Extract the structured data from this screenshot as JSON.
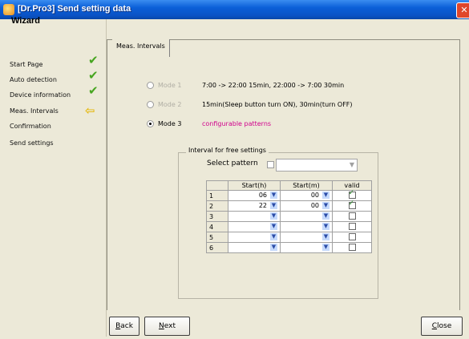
{
  "window": {
    "title": "[Dr.Pro3] Send setting data",
    "close_label": "✕"
  },
  "wizard": {
    "title": "Wizard",
    "steps": [
      {
        "label": "Start Page",
        "status": "done"
      },
      {
        "label": "Auto detection",
        "status": "done"
      },
      {
        "label": "Device information",
        "status": "done"
      },
      {
        "label": "Meas. Intervals",
        "status": "current"
      },
      {
        "label": "Confirmation",
        "status": "pending"
      },
      {
        "label": "Send settings",
        "status": "pending"
      }
    ]
  },
  "tabs": [
    {
      "label": "Meas. Intervals"
    }
  ],
  "modes": [
    {
      "label": "Mode 1",
      "description": "7:00 -> 22:00 15min, 22:000 -> 7:00 30min",
      "selected": false,
      "enabled": false
    },
    {
      "label": "Mode 2",
      "description": "15min(Sleep button turn ON), 30min(turn OFF)",
      "selected": false,
      "enabled": false
    },
    {
      "label": "Mode 3",
      "description": "configurable patterns",
      "selected": true,
      "enabled": true
    }
  ],
  "free_settings": {
    "group_title": "Interval for free settings",
    "select_pattern_label": "Select pattern",
    "select_pattern_checked": false,
    "pattern_value": "",
    "columns": [
      "Start(h)",
      "Start(m)",
      "valid"
    ],
    "rows": [
      {
        "num": "1",
        "hour": "06",
        "minute": "00",
        "valid": true
      },
      {
        "num": "2",
        "hour": "22",
        "minute": "00",
        "valid": true
      },
      {
        "num": "3",
        "hour": "",
        "minute": "",
        "valid": false
      },
      {
        "num": "4",
        "hour": "",
        "minute": "",
        "valid": false
      },
      {
        "num": "5",
        "hour": "",
        "minute": "",
        "valid": false
      },
      {
        "num": "6",
        "hour": "",
        "minute": "",
        "valid": false
      }
    ]
  },
  "buttons": {
    "back": {
      "mnemonic": "B",
      "rest": "ack"
    },
    "next": {
      "mnemonic": "N",
      "rest": "ext"
    },
    "close": {
      "mnemonic": "C",
      "rest": "lose"
    }
  },
  "colors": {
    "titlebar": "#0b5fd8",
    "check": "#47a520",
    "current_arrow": "#e5ba18",
    "mode3_text": "#d0008c"
  },
  "icons": {
    "app": "app-icon",
    "done": "check-icon",
    "current": "arrow-left-icon"
  }
}
